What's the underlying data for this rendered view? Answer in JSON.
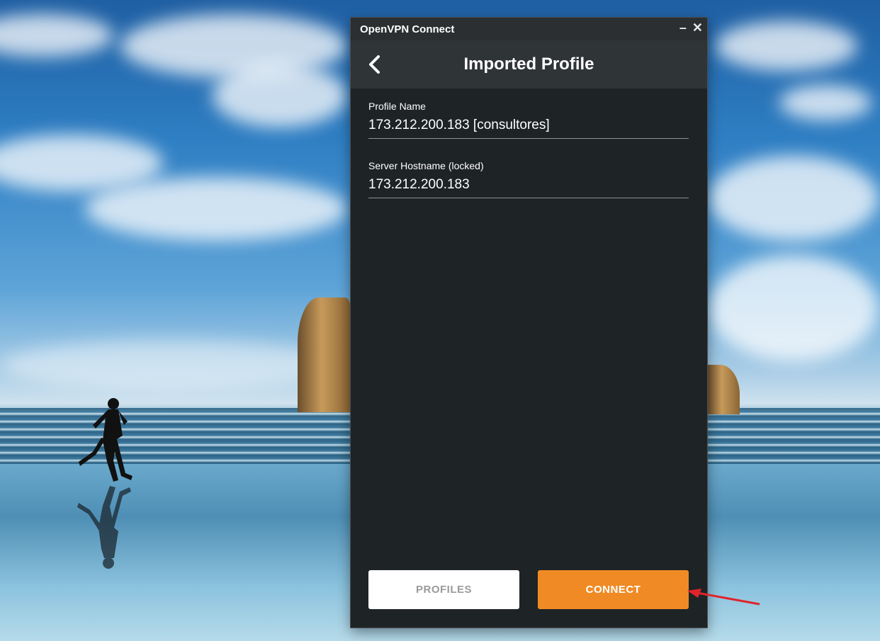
{
  "window": {
    "title": "OpenVPN Connect",
    "controls": {
      "minimize": "–",
      "close": "✕"
    }
  },
  "header": {
    "title": "Imported Profile",
    "back_icon": "chevron-left-icon"
  },
  "fields": [
    {
      "label": "Profile Name",
      "value": "173.212.200.183 [consultores]"
    },
    {
      "label": "Server Hostname (locked)",
      "value": "173.212.200.183"
    }
  ],
  "buttons": {
    "profiles": "PROFILES",
    "connect": "CONNECT"
  },
  "colors": {
    "accent": "#f08a24",
    "background": "#1e2326",
    "header": "#2f3437",
    "annotation_arrow": "#e0242c"
  }
}
